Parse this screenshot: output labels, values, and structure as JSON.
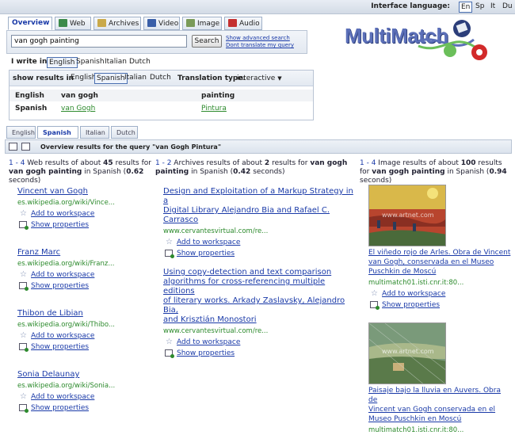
{
  "interface_language": {
    "label": "Interface language:",
    "options": [
      "En",
      "Sp",
      "It",
      "Du"
    ],
    "selected": "En"
  },
  "tabs": [
    {
      "label": "Overview",
      "icon": "overview"
    },
    {
      "label": "Web",
      "icon": "globe-icon"
    },
    {
      "label": "Archives",
      "icon": "archive-icon"
    },
    {
      "label": "Video",
      "icon": "video-icon"
    },
    {
      "label": "Image",
      "icon": "image-icon"
    },
    {
      "label": "Audio",
      "icon": "speaker-icon"
    }
  ],
  "search": {
    "value": "van gogh painting",
    "button": "Search",
    "advanced": "Show advanced search",
    "dont_translate": "Dont translate my query"
  },
  "logo_text": "MultiMatch",
  "write_in": {
    "label": "I write in",
    "options": [
      "English",
      "Spanish",
      "Italian",
      "Dutch"
    ],
    "selected": "English"
  },
  "show_results": {
    "label": "show results in",
    "options": [
      "English",
      "Spanish",
      "Italian",
      "Dutch"
    ],
    "selected": "Spanish",
    "translation_label": "Translation type:",
    "translation_value": "interactive"
  },
  "translation_table": {
    "header": [
      "English",
      "van gogh",
      "painting"
    ],
    "row": [
      "Spanish",
      "van Gogh",
      "Pintura"
    ]
  },
  "result_tabs": [
    "English",
    "Spanish",
    "Italian",
    "Dutch"
  ],
  "result_tab_selected": "Spanish",
  "overview_title": "Overview results for the query \"van Gogh Pintura\"",
  "web": {
    "range": "1 - 4",
    "pre": "Web results of about",
    "count": "45",
    "mid": "results for",
    "query": "van gogh painting",
    "lang": "in Spanish (",
    "secs": "0.62",
    "post": "seconds)",
    "results": [
      {
        "title": "Vincent  van  Gogh",
        "url": "es.wikipedia.org/wiki/Vince..."
      },
      {
        "title": "Franz  Marc",
        "url": "es.wikipedia.org/wiki/Franz..."
      },
      {
        "title": "Thibon  de  Libian",
        "url": "es.wikipedia.org/wiki/Thibo..."
      },
      {
        "title": "Sonia  Delaunay",
        "url": "es.wikipedia.org/wiki/Sonia..."
      }
    ]
  },
  "archives": {
    "range": "1 - 2",
    "pre": "Archives results of about",
    "count": "2",
    "mid": "results for",
    "query": "van gogh painting",
    "lang": "in Spanish (",
    "secs": "0.42",
    "post": "seconds)",
    "results": [
      {
        "title_lines": [
          "Design and Exploitation of a Markup Strategy in a",
          "Digital Library Alejandro Bia and Rafael C.",
          "Carrasco"
        ],
        "url": "www.cervantesvirtual.com/re..."
      },
      {
        "title_lines": [
          "Using copy-detection and text comparison",
          "algorithms for cross-referencing multiple editions",
          "of literary works. Arkady Zaslavsky, Alejandro Bia,",
          "and Krisztián Monostori"
        ],
        "url": "www.cervantesvirtual.com/re..."
      }
    ]
  },
  "images": {
    "range": "1 - 4",
    "pre": "Image results of about",
    "count": "100",
    "mid": "results for",
    "query": "van gogh painting",
    "lang": "in Spanish (",
    "secs": "0.94",
    "post": "seconds)",
    "results": [
      {
        "caption_lines": [
          "El viñedo rojo de Arles. Obra de Vincent",
          "van Gogh, conservada en el Museo",
          "Puschkin de Moscú"
        ],
        "url": "multimatch01.isti.cnr.it:80..."
      },
      {
        "caption_lines": [
          "Paisaje bajo la lluvia en Auvers. Obra de",
          "Vincent van Gogh conservada en el",
          "Museo Puschkin en Moscú"
        ],
        "url": "multimatch01.isti.cnr.it:80..."
      }
    ],
    "watermark": "www.artnet.com"
  },
  "actions": {
    "add": "Add to workspace",
    "props": "Show properties"
  },
  "colors": {
    "link": "#1a3aa8",
    "url": "#2c8a2c",
    "panel": "#e3e9f1",
    "border": "#b9c4d4"
  }
}
